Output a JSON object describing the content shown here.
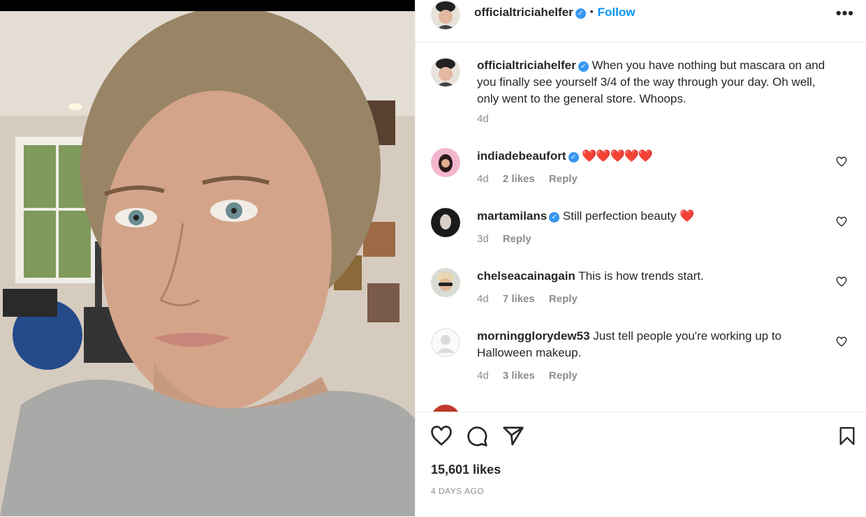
{
  "header": {
    "username": "officialtriciahelfer",
    "separator": "•",
    "follow_label": "Follow",
    "more_label": "•••"
  },
  "caption": {
    "username": "officialtriciahelfer",
    "text": "When you have nothing but mascara on and you finally see yourself 3/4 of the way through your day. Oh well, only went to the general store. Whoops.",
    "time": "4d"
  },
  "comments": [
    {
      "username": "indiadebeaufort",
      "verified": true,
      "text": "❤️❤️❤️❤️❤️",
      "time": "4d",
      "likes": "2 likes",
      "reply": "Reply"
    },
    {
      "username": "martamilans",
      "verified": true,
      "text": "Still perfection beauty ❤️",
      "time": "3d",
      "likes": "",
      "reply": "Reply"
    },
    {
      "username": "chelseacainagain",
      "verified": false,
      "text": "This is how trends start.",
      "time": "4d",
      "likes": "7 likes",
      "reply": "Reply"
    },
    {
      "username": "morningglorydew53",
      "verified": false,
      "text": "Just tell people you're working up to Halloween makeup.",
      "time": "4d",
      "likes": "3 likes",
      "reply": "Reply"
    }
  ],
  "footer": {
    "likes": "15,601 likes",
    "date": "4 DAYS AGO"
  },
  "icons": {
    "verified": "verified-badge-icon",
    "like": "heart-icon",
    "comment": "comment-icon",
    "share": "paper-plane-icon",
    "save": "bookmark-icon"
  },
  "colors": {
    "accent": "#0095f6",
    "verified": "#3897f0",
    "muted": "#8e8e8e"
  }
}
